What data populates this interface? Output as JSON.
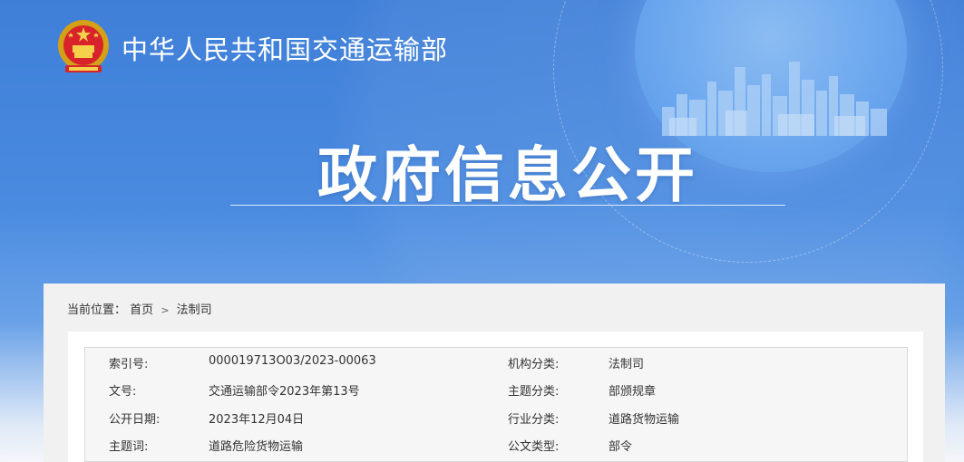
{
  "header": {
    "site_title": "中华人民共和国交通运输部",
    "logo_icon": "national-emblem-icon"
  },
  "hero": {
    "title": "政府信息公开"
  },
  "breadcrumb": {
    "prefix": "当前位置：",
    "items": [
      "首页",
      "法制司"
    ],
    "separator": ">"
  },
  "meta": {
    "rows": [
      {
        "label1": "索引号:",
        "value1": "000019713O03/2023-00063",
        "label2": "机构分类:",
        "value2": "法制司"
      },
      {
        "label1": "文号:",
        "value1": "交通运输部令2023年第13号",
        "label2": "主题分类:",
        "value2": "部颁规章"
      },
      {
        "label1": "公开日期:",
        "value1": "2023年12月04日",
        "label2": "行业分类:",
        "value2": "道路货物运输"
      },
      {
        "label1": "主题词:",
        "value1": "道路危险货物运输",
        "label2": "公文类型:",
        "value2": "部令"
      }
    ]
  },
  "colors": {
    "banner_blue": "#3f7fd8",
    "text": "#333333",
    "white": "#ffffff"
  }
}
